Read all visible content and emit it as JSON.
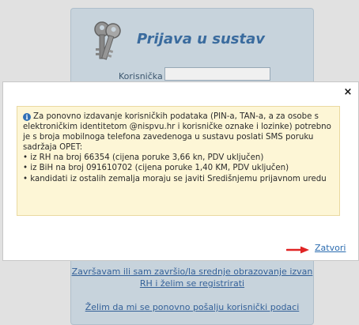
{
  "login": {
    "title": "Prijava u sustav",
    "username_label": "Korisnička",
    "username_value": "",
    "link_abroad": "Završavam ili sam završio/la srednje obrazovanje izvan RH i želim se registrirati",
    "link_resend": "Želim da mi se ponovno pošalju korisnički podaci"
  },
  "modal": {
    "close_symbol": "×",
    "info_icon": "i",
    "info_lines": [
      "Za ponovno izdavanje korisničkih podataka (PIN-a, TAN-a, a za osobe s elektroničkim identitetom @nispvu.hr i korisničke oznake i lozinke) potrebno je s broja mobilnoga telefona zavedenoga u sustavu poslati SMS poruku sadržaja OPET:",
      "• iz RH na broj 66354 (cijena poruke 3,66 kn, PDV uključen)",
      "• iz BiH na broj 091610702 (cijena poruke 1,40 KM, PDV uključen)",
      "• kandidati iz ostalih zemalja moraju se javiti Središnjemu prijavnom uredu"
    ],
    "close_link": "Zatvori"
  },
  "colors": {
    "title": "#3a6fa6",
    "link": "#2b6cb0",
    "info_bg": "#fdf6d6",
    "arrow": "#e02424"
  },
  "icons": {
    "keys": "keys-icon",
    "info": "info-icon",
    "close": "close-icon",
    "arrow": "arrow-right-icon"
  }
}
